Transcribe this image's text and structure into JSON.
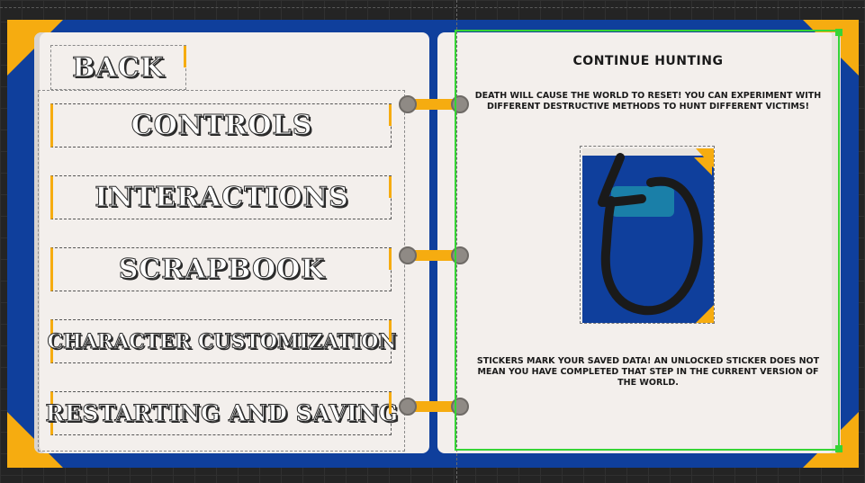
{
  "menu": {
    "back_label": "BACK",
    "items": [
      {
        "label": "CONTROLS"
      },
      {
        "label": "INTERACTIONS"
      },
      {
        "label": "SCRAPBOOK"
      },
      {
        "label": "CHARACTER CUSTOMIZATION"
      },
      {
        "label": "RESTARTING AND SAVING"
      }
    ]
  },
  "detail": {
    "title": "CONTINUE HUNTING",
    "description": "Death will cause the world to reset! You can experiment with different destructive methods to hunt different victims!",
    "sticker_icon": "restart-arrow-book-icon",
    "note": "Stickers mark your saved data! An unlocked sticker does not mean you have completed that step in the current version of the world."
  },
  "colors": {
    "cover": "#0f3f9c",
    "accent": "#f6ac10",
    "page": "#f3efec",
    "selection": "#36d436"
  }
}
